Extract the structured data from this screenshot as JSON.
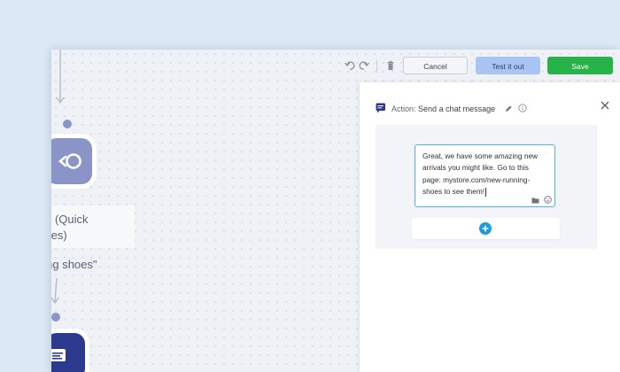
{
  "toolbar": {
    "cancel_label": "Cancel",
    "test_label": "Test it out",
    "save_label": "Save"
  },
  "canvas": {
    "node_label_line1": "ssion (Quick",
    "node_label_line2": "Replies)",
    "edge_label": "ning shoes\""
  },
  "panel": {
    "header_prefix": "Action:",
    "header_title": "Send a chat message",
    "message_text": "Great, we have some amazing new arrivals you might like. Go to this page: mystore.com/new-running-shoes to see them!"
  },
  "colors": {
    "accent_blue": "#1b9be0",
    "save_green": "#27b24a",
    "test_blue": "#a9c4f2",
    "node_purple": "#8b94c6",
    "node_navy": "#2b3a8c"
  }
}
